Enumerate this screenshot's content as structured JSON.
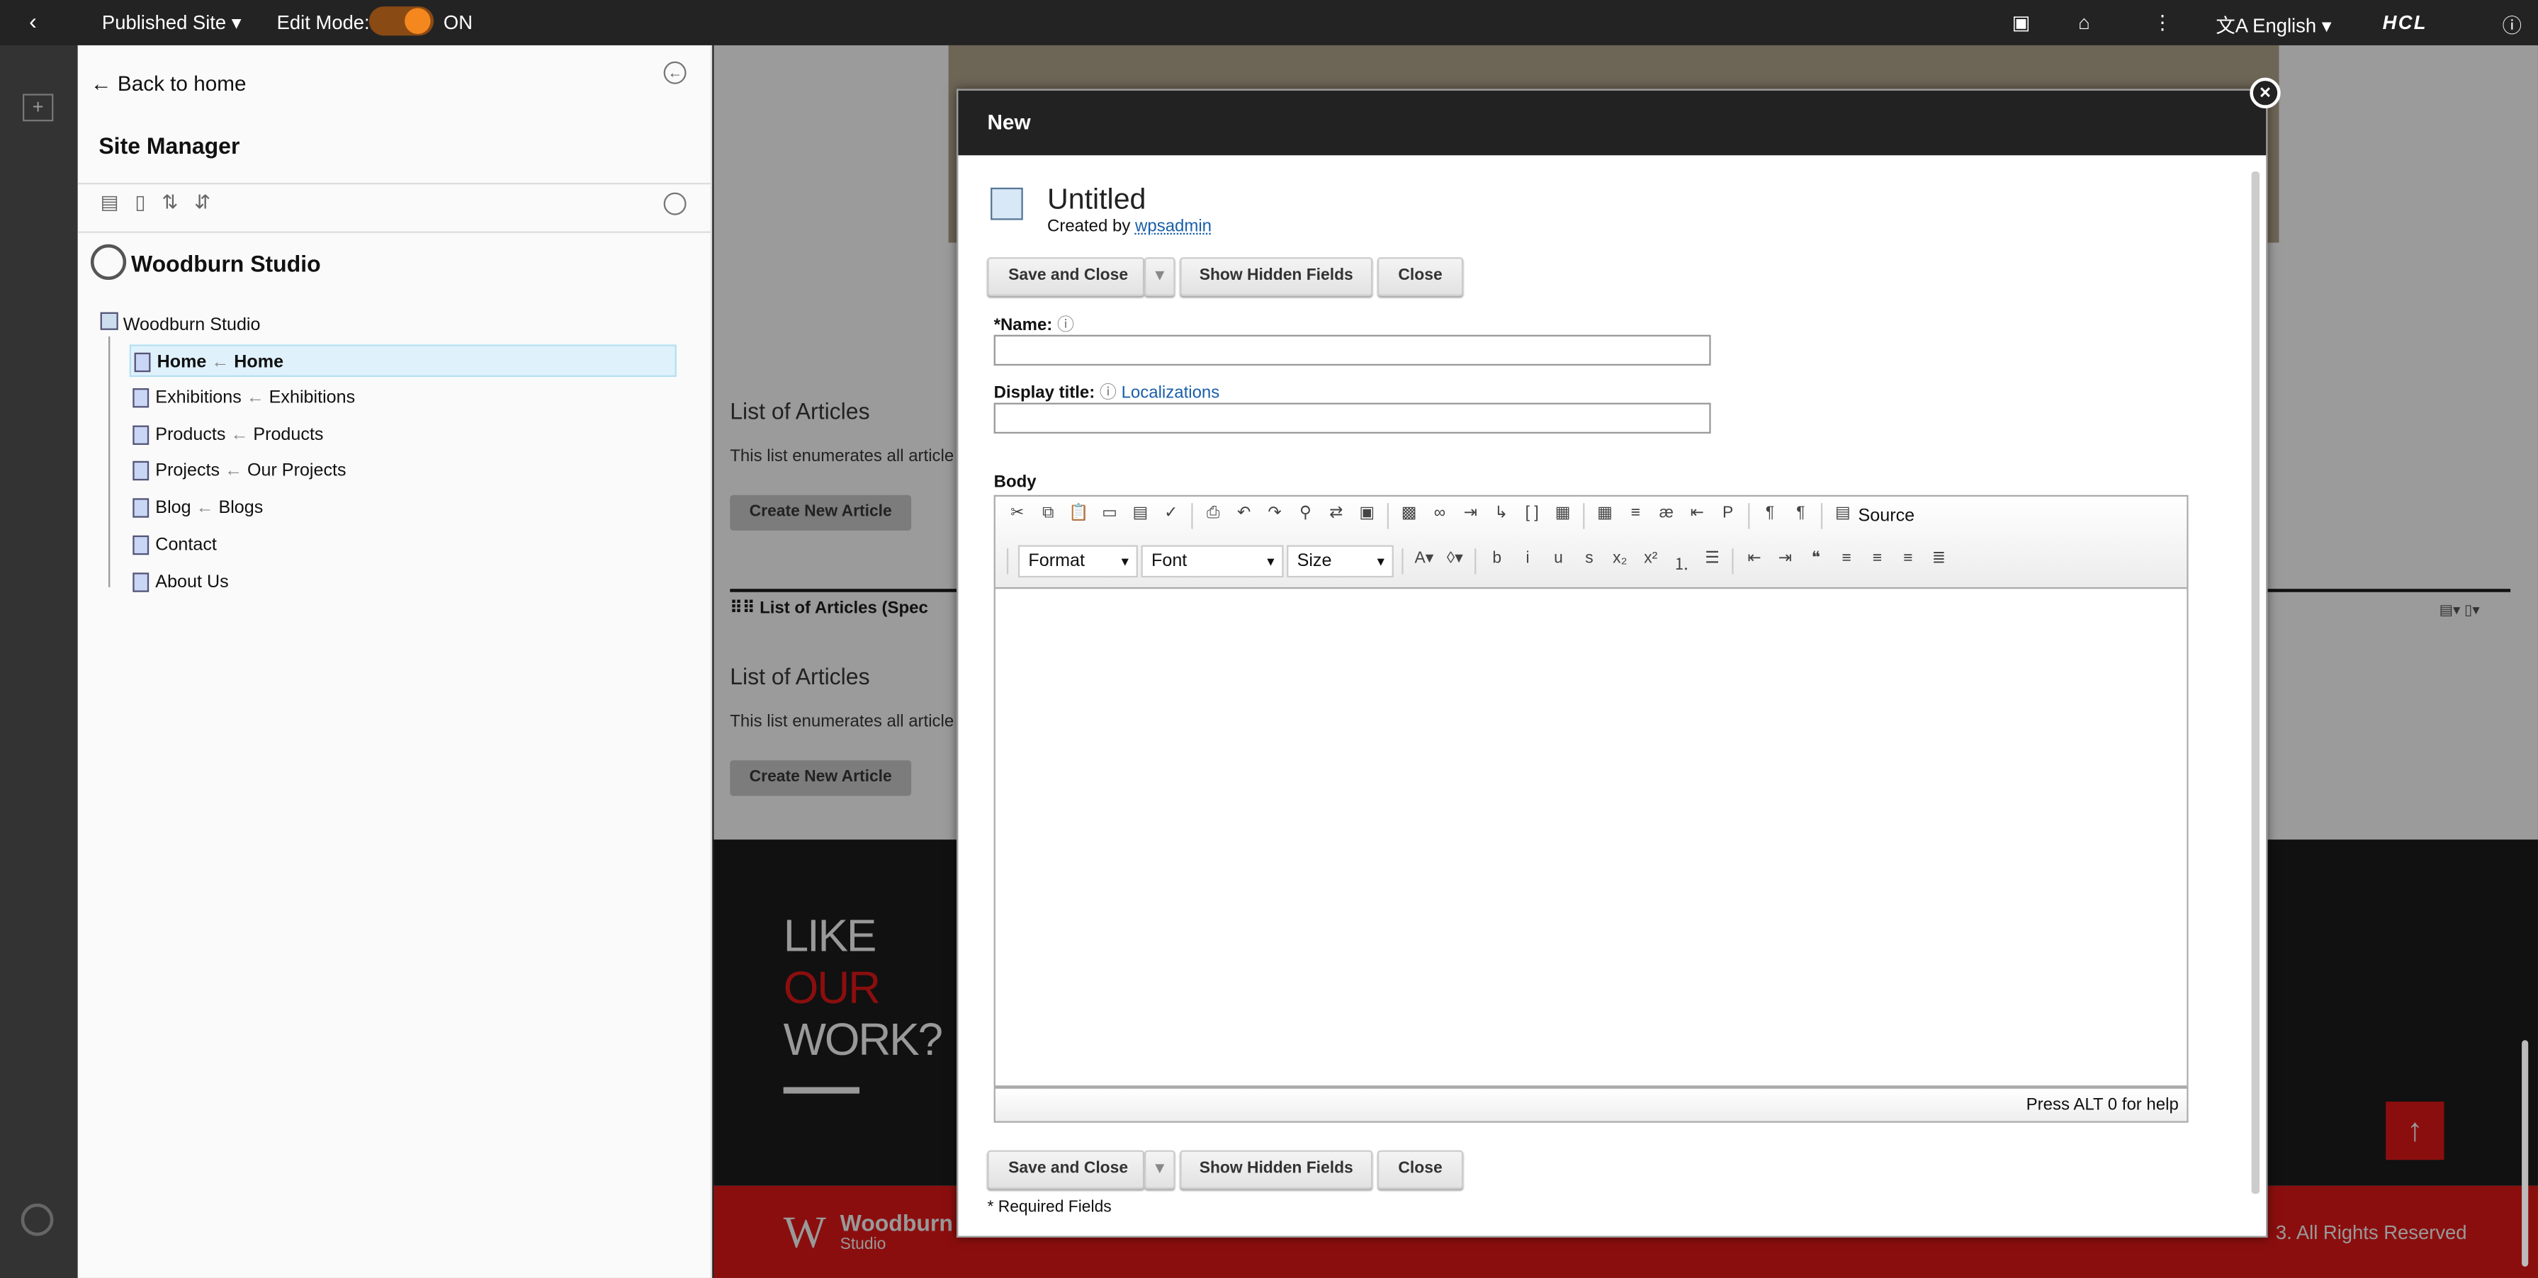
{
  "topbar": {
    "site_selector": "Published Site",
    "edit_mode_label": "Edit Mode:",
    "edit_mode_state": "ON",
    "language": "English",
    "brand": "HCL",
    "edit_mode_on": true,
    "accent_color": "#f5871f"
  },
  "sidebar": {
    "back": "Back to home",
    "title": "Site Manager",
    "site_name": "Woodburn Studio",
    "tree_root": "Woodburn Studio",
    "items": [
      {
        "name": "Home",
        "target": "Home",
        "selected": true
      },
      {
        "name": "Exhibitions",
        "target": "Exhibitions"
      },
      {
        "name": "Products",
        "target": "Products"
      },
      {
        "name": "Projects",
        "target": "Our Projects"
      },
      {
        "name": "Blog",
        "target": "Blogs"
      },
      {
        "name": "Contact",
        "target": ""
      },
      {
        "name": "About Us",
        "target": ""
      }
    ]
  },
  "page": {
    "list_title_1": "List of Articles",
    "list_desc_1": "This list enumerates all article",
    "create_1": "Create New Article",
    "portlet_title": "List of Articles (Spec",
    "list_title_2": "List of Articles",
    "list_desc_2": "This list enumerates all article",
    "create_2": "Create New Article",
    "cta_1": "LIKE",
    "cta_2": "OUR",
    "cta_3": "WORK?",
    "footer_brand": "Woodburn",
    "footer_sub": "Studio",
    "copyright": "3. All Rights Reserved",
    "brand_red": "#8b0e0e"
  },
  "modal": {
    "title": "New",
    "doc_title": "Untitled",
    "created_by_label": "Created by",
    "created_by_user": "wpsadmin",
    "save_close": "Save and Close",
    "show_hidden": "Show Hidden Fields",
    "close": "Close",
    "name_label": "*Name:",
    "display_title_label": "Display title:",
    "localizations": "Localizations",
    "name_value": "",
    "display_title_value": "",
    "body_label": "Body",
    "source": "Source",
    "format": "Format",
    "font": "Font",
    "size": "Size",
    "help": "Press ALT 0 for help",
    "required": "* Required Fields"
  },
  "toolbar1": [
    [
      "cut-icon",
      "✂"
    ],
    [
      "copy-icon",
      "⧉"
    ],
    [
      "paste-icon",
      "📋"
    ],
    [
      "paste-text-icon",
      "▭"
    ],
    [
      "paste-word-icon",
      "▤"
    ],
    [
      "spellcheck-icon",
      "✓"
    ],
    "|",
    [
      "print-icon",
      "⎙"
    ],
    [
      "undo-icon",
      "↶"
    ],
    [
      "redo-icon",
      "↷"
    ],
    [
      "find-icon",
      "⚲"
    ],
    [
      "replace-icon",
      "⇄"
    ],
    [
      "select-all-icon",
      "▣"
    ],
    "|",
    [
      "image-icon",
      "▩"
    ],
    [
      "link-icon",
      "∞"
    ],
    [
      "anchor-icon",
      "⇥"
    ],
    [
      "unlink-icon",
      "↳"
    ],
    [
      "brackets-icon",
      "[ ]"
    ],
    [
      "embed-icon",
      "▦"
    ],
    "|",
    [
      "table-icon",
      "▦"
    ],
    [
      "hr-icon",
      "≡"
    ],
    [
      "special-char-icon",
      "æ"
    ],
    [
      "indent-icon",
      "⇤"
    ],
    [
      "page-break-icon",
      "P"
    ],
    "|",
    [
      "ltr-icon",
      "¶"
    ],
    [
      "rtl-icon",
      "¶"
    ],
    "|"
  ],
  "toolbar2": [
    [
      "text-color-icon",
      "A▾"
    ],
    [
      "bg-color-icon",
      "◊▾"
    ],
    "|",
    [
      "bold-icon",
      "b"
    ],
    [
      "italic-icon",
      "i"
    ],
    [
      "underline-icon",
      "u"
    ],
    [
      "strike-icon",
      "s"
    ],
    [
      "subscript-icon",
      "x₂"
    ],
    [
      "superscript-icon",
      "x²"
    ],
    [
      "numbered-list-icon",
      "⒈"
    ],
    [
      "bullet-list-icon",
      "☰"
    ],
    "|",
    [
      "outdent-icon",
      "⇤"
    ],
    [
      "indent-more-icon",
      "⇥"
    ],
    [
      "blockquote-icon",
      "❝"
    ],
    [
      "align-left-icon",
      "≡"
    ],
    [
      "align-center-icon",
      "≡"
    ],
    [
      "align-right-icon",
      "≡"
    ],
    [
      "justify-icon",
      "≣"
    ]
  ]
}
